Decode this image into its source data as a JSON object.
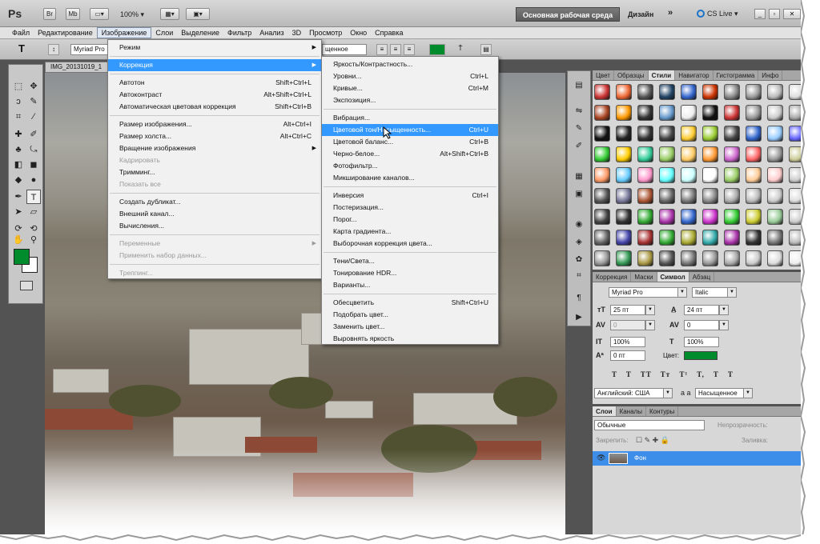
{
  "appbar": {
    "logo": "Ps",
    "br": "Br",
    "mb": "Mb",
    "zoom": "100%",
    "workspace": "Основная рабочая среда",
    "design": "Дизайн",
    "more": "»",
    "cs_live": "CS Live"
  },
  "menubar": [
    "Файл",
    "Редактирование",
    "Изображение",
    "Слои",
    "Выделение",
    "Фильтр",
    "Анализ",
    "3D",
    "Просмотр",
    "Окно",
    "Справка"
  ],
  "optbar": {
    "font": "Myriad Pro",
    "aa": "щенное"
  },
  "document": {
    "tab": "IMG_20131019_1"
  },
  "image_menu": {
    "items": [
      {
        "label": "Режим",
        "submenu": true
      },
      {
        "sep": true
      },
      {
        "label": "Коррекция",
        "submenu": true,
        "hl": true
      },
      {
        "sep": true
      },
      {
        "label": "Автотон",
        "shortcut": "Shift+Ctrl+L"
      },
      {
        "label": "Автоконтраст",
        "shortcut": "Alt+Shift+Ctrl+L"
      },
      {
        "label": "Автоматическая цветовая коррекция",
        "shortcut": "Shift+Ctrl+B"
      },
      {
        "sep": true
      },
      {
        "label": "Размер изображения...",
        "shortcut": "Alt+Ctrl+I"
      },
      {
        "label": "Размер холста...",
        "shortcut": "Alt+Ctrl+C"
      },
      {
        "label": "Вращение изображения",
        "submenu": true
      },
      {
        "label": "Кадрировать",
        "dis": true
      },
      {
        "label": "Тримминг..."
      },
      {
        "label": "Показать все",
        "dis": true
      },
      {
        "sep": true
      },
      {
        "label": "Создать дубликат..."
      },
      {
        "label": "Внешний канал..."
      },
      {
        "label": "Вычисления..."
      },
      {
        "sep": true
      },
      {
        "label": "Переменные",
        "submenu": true,
        "dis": true
      },
      {
        "label": "Применить набор данных...",
        "dis": true
      },
      {
        "sep": true
      },
      {
        "label": "Треппинг...",
        "dis": true
      }
    ]
  },
  "correction_menu": {
    "items": [
      {
        "label": "Яркость/Контрастность..."
      },
      {
        "label": "Уровни...",
        "shortcut": "Ctrl+L"
      },
      {
        "label": "Кривые...",
        "shortcut": "Ctrl+M"
      },
      {
        "label": "Экспозиция..."
      },
      {
        "sep": true
      },
      {
        "label": "Вибрация..."
      },
      {
        "label": "Цветовой тон/Насыщенность...",
        "shortcut": "Ctrl+U",
        "hl": true
      },
      {
        "label": "Цветовой баланс...",
        "shortcut": "Ctrl+B"
      },
      {
        "label": "Черно-белое...",
        "shortcut": "Alt+Shift+Ctrl+B"
      },
      {
        "label": "Фотофильтр..."
      },
      {
        "label": "Микширование каналов..."
      },
      {
        "sep": true
      },
      {
        "label": "Инверсия",
        "shortcut": "Ctrl+I"
      },
      {
        "label": "Постеризация..."
      },
      {
        "label": "Порог..."
      },
      {
        "label": "Карта градиента..."
      },
      {
        "label": "Выборочная коррекция цвета..."
      },
      {
        "sep": true
      },
      {
        "label": "Тени/Света..."
      },
      {
        "label": "Тонирование HDR..."
      },
      {
        "label": "Варианты..."
      },
      {
        "sep": true
      },
      {
        "label": "Обесцветить",
        "shortcut": "Shift+Ctrl+U"
      },
      {
        "label": "Подобрать цвет..."
      },
      {
        "label": "Заменить цвет..."
      },
      {
        "label": "Выровнять яркость"
      }
    ]
  },
  "styles_panel": {
    "tabs": [
      "Цвет",
      "Образцы",
      "Стили",
      "Навигатор",
      "Гистограмма",
      "Инфо"
    ],
    "active": "Стили"
  },
  "char_panel": {
    "tabs": [
      "Коррекция",
      "Маски",
      "Символ",
      "Абзац"
    ],
    "active": "Символ",
    "font": "Myriad Pro",
    "style": "Italic",
    "size": "25 пт",
    "leading": "24 пт",
    "kerning": "0",
    "tracking": "0",
    "vscale": "100%",
    "hscale": "100%",
    "baseline": "0 пт",
    "color_label": "Цвет:",
    "language": "Английский: США",
    "aa_label": "a a",
    "aa": "Насыщенное",
    "typo": "T T TT Tт T¹ T, T T"
  },
  "layers_panel": {
    "tabs": [
      "Слои",
      "Каналы",
      "Контуры"
    ],
    "active": "Слои",
    "blend": "Обычные",
    "opacity_label": "Непрозрачность:",
    "lock_label": "Закрепить:",
    "fill_label": "Заливка:",
    "layer_name": "Фон"
  },
  "colors": {
    "accent": "#3399ff",
    "foreground": "#008c2d"
  }
}
